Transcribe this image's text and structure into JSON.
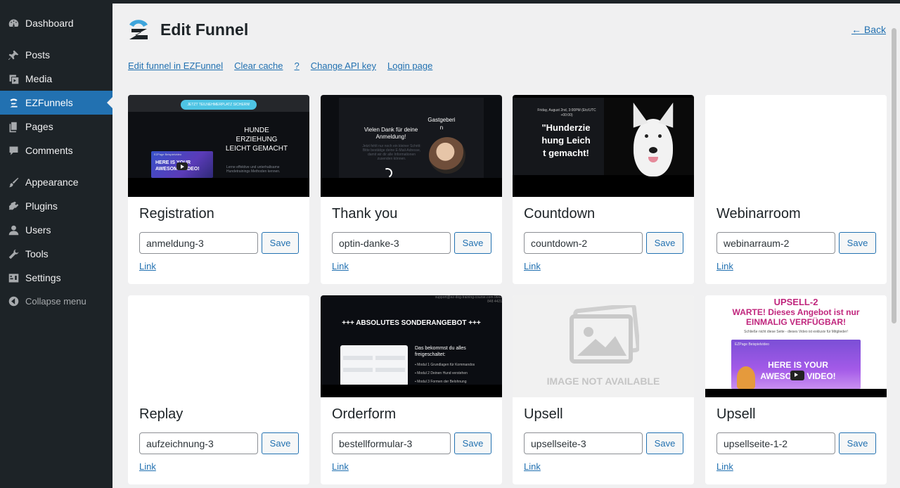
{
  "sidebar": {
    "items": [
      {
        "label": "Dashboard",
        "icon": "dashboard-icon"
      },
      {
        "label": "Posts",
        "icon": "pin-icon"
      },
      {
        "label": "Media",
        "icon": "media-icon"
      },
      {
        "label": "EZFunnels",
        "icon": "ezfunnels-icon",
        "active": true
      },
      {
        "label": "Pages",
        "icon": "pages-icon"
      },
      {
        "label": "Comments",
        "icon": "comment-icon"
      },
      {
        "label": "Appearance",
        "icon": "paintbrush-icon"
      },
      {
        "label": "Plugins",
        "icon": "plugin-icon"
      },
      {
        "label": "Users",
        "icon": "user-icon"
      },
      {
        "label": "Tools",
        "icon": "wrench-icon"
      },
      {
        "label": "Settings",
        "icon": "settings-icon"
      }
    ],
    "collapse_label": "Collapse menu"
  },
  "header": {
    "title": "Edit Funnel",
    "back_label": "← Back"
  },
  "links": [
    "Edit funnel in EZFunnel",
    "Clear cache",
    "?",
    "Change API key",
    "Login page"
  ],
  "save_label": "Save",
  "link_label": "Link",
  "cards": [
    {
      "title": "Registration",
      "slug": "anmeldung-3",
      "thumb": {
        "pill": "JETZT TEILNEHMERPLATZ SICHERN!",
        "headline": "HUNDE ERZIEHUNG LEICHT GEMACHT",
        "sub": "Lerne effektive und unterhaltsame Hundetrainings Methoden kennen.",
        "video_text": "HERE IS YOUR AWESOME VIDEO!",
        "video_channel": "EZPage Beispielvideo"
      }
    },
    {
      "title": "Thank you",
      "slug": "optin-danke-3",
      "thumb": {
        "headline": "Vielen Dank für deine Anmeldung!",
        "sub": "Jetzt fehlt nur noch ein kleiner Schritt: Bitte bestätige deine E-Mail-Adresse, damit wir dir alle Informationen zusenden können.",
        "host": "Gastgeberin"
      }
    },
    {
      "title": "Countdown",
      "slug": "countdown-2",
      "thumb": {
        "date": "Friday, August 2nd, 3:00PM (Etc/UTC +00:00)",
        "headline": "\"Hunderziehung Leicht gemacht!"
      }
    },
    {
      "title": "Webinarroom",
      "slug": "webinarraum-2",
      "thumb": {}
    },
    {
      "title": "Replay",
      "slug": "aufzeichnung-3",
      "thumb": {}
    },
    {
      "title": "Orderform",
      "slug": "bestellformular-3",
      "thumb": {
        "top_note": "support@ez-dog-training-course.com 0661 848 4421",
        "headline": "+++ ABSOLUTES SONDERANGEBOT +++",
        "list_title": "Das bekommst du alles freigeschaltet:",
        "list": [
          "Modul 1 Grundlagen für Kommandos",
          "Modul 2 Deinen Hund verstehen",
          "Modul 3 Formen der Belohnung"
        ]
      }
    },
    {
      "title": "Upsell",
      "slug": "upsellseite-3",
      "thumb": {
        "placeholder": "IMAGE NOT AVAILABLE"
      }
    },
    {
      "title": "Upsell",
      "slug": "upsellseite-1-2",
      "thumb": {
        "kicker": "UPSELL-2",
        "headline": "WARTE! Dieses Angebot ist nur EINMALIG VERFÜGBAR!",
        "sub": "Schließe nicht diese Seite - dieses Video ist exklusiv für Mitglieder!",
        "video_text": "HERE IS YOUR AWESOME VIDEO!",
        "video_channel": "EZPage Beispielvideo"
      }
    }
  ],
  "colors": {
    "sidebar_bg": "#1d2327",
    "active": "#2271b1",
    "link": "#2271b1",
    "page_bg": "#f0f0f1"
  }
}
